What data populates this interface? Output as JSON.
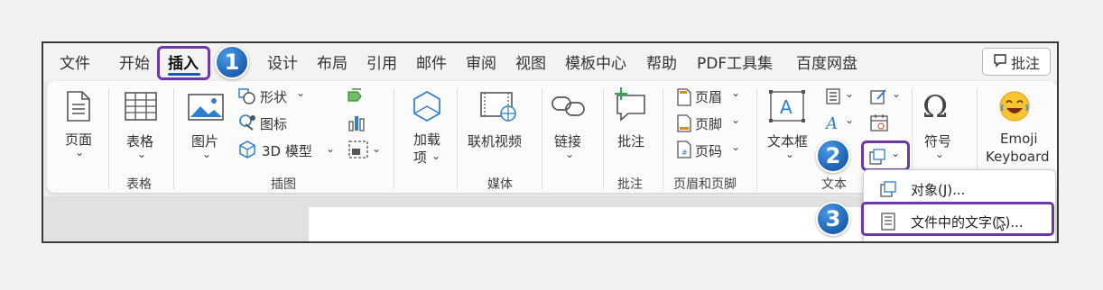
{
  "tabs": [
    "文件",
    "开始",
    "插入",
    "设计",
    "布局",
    "引用",
    "邮件",
    "审阅",
    "视图",
    "模板中心",
    "帮助",
    "PDF工具集",
    "百度网盘"
  ],
  "active_tab": "插入",
  "comment_button": "批注",
  "ribbon": {
    "page": "页面",
    "table": "表格",
    "picture": "图片",
    "shapes": "形状",
    "icons": "图标",
    "model3d": "3D 模型",
    "addin_1": "加载",
    "addin_2": "项",
    "online_video": "联机视频",
    "link": "链接",
    "comment": "批注",
    "header": "页眉",
    "footer": "页脚",
    "page_number": "页码",
    "textbox": "文本框",
    "symbol": "符号",
    "emoji_1": "Emoji",
    "emoji_2": "Keyboard",
    "chevron": "⌄"
  },
  "groups": {
    "table": "表格",
    "illustrations": "插图",
    "media": "媒体",
    "comments": "批注",
    "header_footer": "页眉和页脚",
    "text": "文本"
  },
  "dropdown": {
    "object": "对象(J)...",
    "text_from_file": "文件中的文字(F)..."
  },
  "badges": [
    "1",
    "2",
    "3"
  ],
  "colors": {
    "accent": "#1a56b0",
    "highlight": "#6a3aa8",
    "badge": "#1d5fb0"
  },
  "icons": [
    "comment-icon",
    "page-icon",
    "table-icon",
    "picture-icon",
    "shapes-icon",
    "icons-icon",
    "3d-model-icon",
    "smartart-icon",
    "chart-icon",
    "screenshot-icon",
    "addins-icon",
    "online-video-icon",
    "link-icon",
    "comment-insert-icon",
    "header-icon",
    "footer-icon",
    "page-number-icon",
    "textbox-icon",
    "quick-parts-icon",
    "wordart-icon",
    "signature-line-icon",
    "date-time-icon",
    "object-icon",
    "omega-icon",
    "emoji-icon",
    "cursor-icon"
  ]
}
